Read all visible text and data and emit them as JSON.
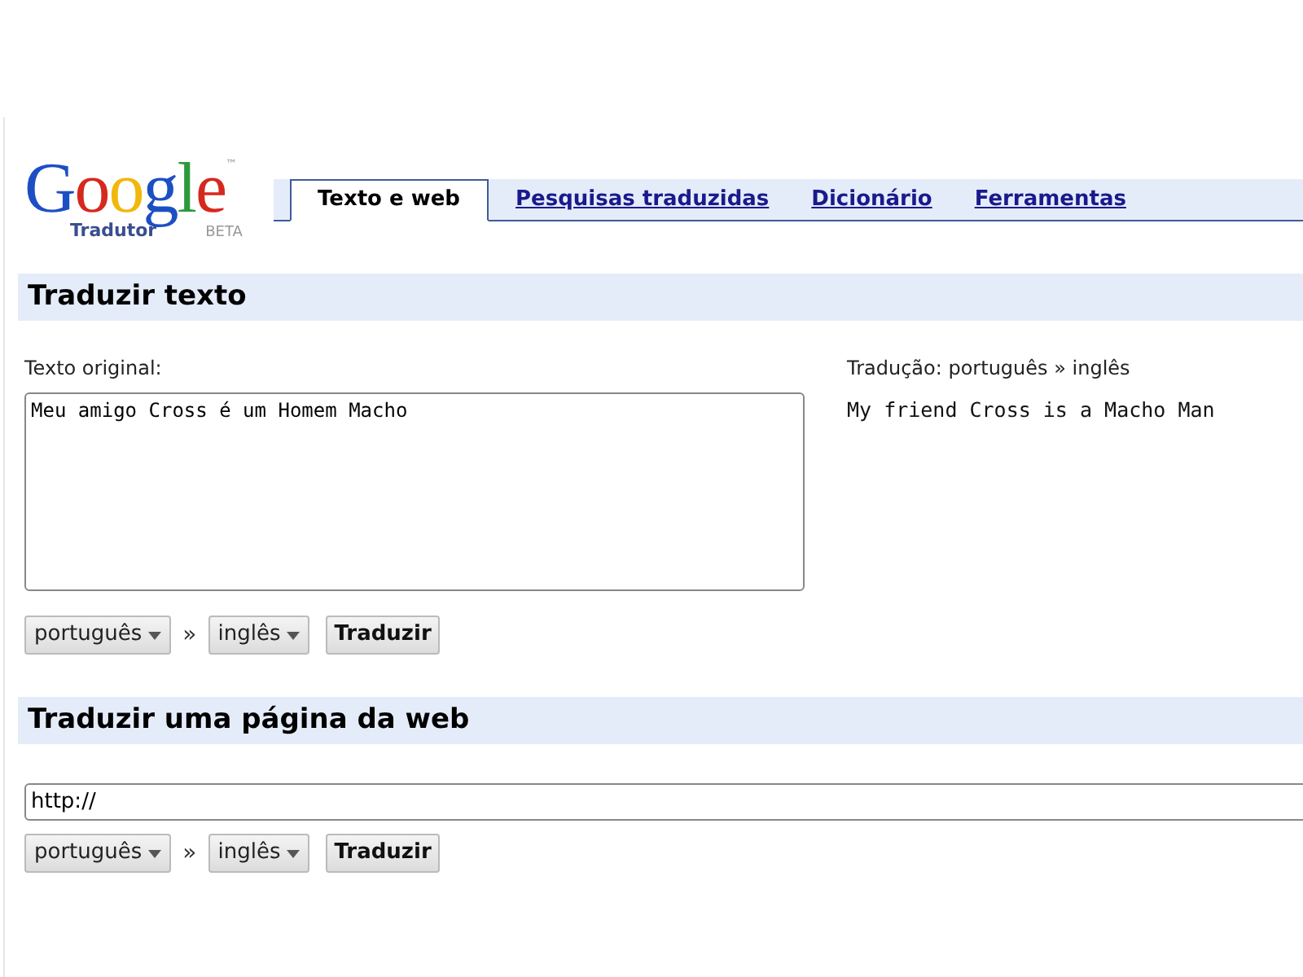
{
  "logo": {
    "word": "Google",
    "trademark": "™",
    "subtitle": "Tradutor",
    "badge": "BETA"
  },
  "tabs": [
    {
      "label": "Texto e web",
      "selected": true
    },
    {
      "label": "Pesquisas traduzidas",
      "selected": false
    },
    {
      "label": "Dicionário",
      "selected": false
    },
    {
      "label": "Ferramentas",
      "selected": false
    }
  ],
  "text_section": {
    "title": "Traduzir texto",
    "source_label": "Texto original:",
    "source_text": "Meu amigo Cross é um Homem Macho",
    "from": "português",
    "separator": "»",
    "to": "inglês",
    "button": "Traduzir",
    "result_label": "Tradução: português » inglês",
    "result_text": "My friend Cross is a Macho Man"
  },
  "web_section": {
    "title": "Traduzir uma página da web",
    "url": "http://",
    "from": "português",
    "separator": "»",
    "to": "inglês",
    "button": "Traduzir"
  }
}
